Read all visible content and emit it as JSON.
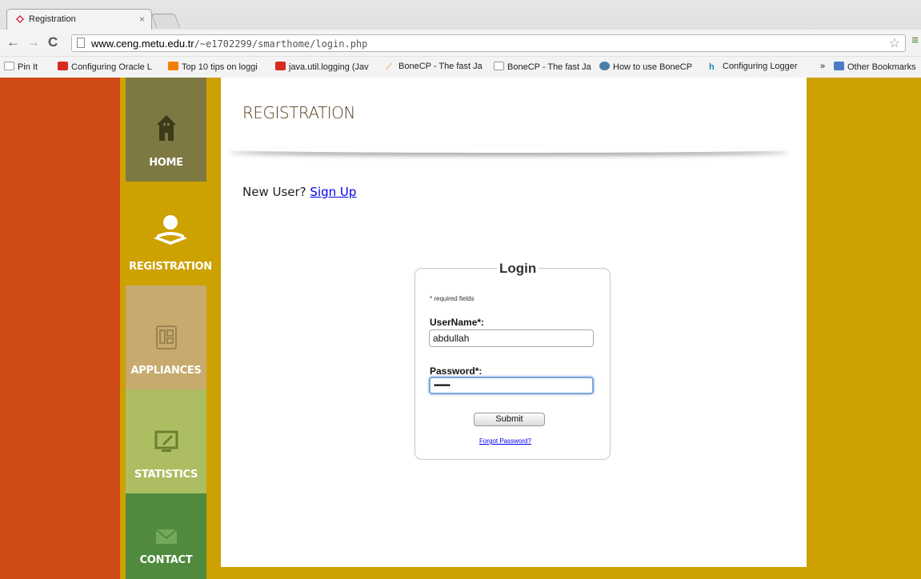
{
  "browser": {
    "tab_title": "Registration",
    "tab_close": "×",
    "url_host": "www.ceng.metu.edu.tr",
    "url_path": "/~e1702299/smarthome/login.php",
    "bookmarks": [
      {
        "label": "Pin It",
        "icon": "page-icon"
      },
      {
        "label": "Configuring Oracle L",
        "icon": "oracle-icon"
      },
      {
        "label": "Top 10 tips on loggi",
        "icon": "blogger-icon"
      },
      {
        "label": "java.util.logging (Jav",
        "icon": "oracle-icon"
      },
      {
        "label": "BoneCP - The fast Ja",
        "icon": "bone-icon"
      },
      {
        "label": "BoneCP - The fast Ja",
        "icon": "page-icon"
      },
      {
        "label": "How to use BoneCP ",
        "icon": "wordpress-icon"
      },
      {
        "label": "Configuring Logger ",
        "icon": "hn-icon"
      }
    ],
    "bookmarks_overflow": "»",
    "other_bookmarks": "Other Bookmarks"
  },
  "nav": {
    "home": "HOME",
    "registration": "REGISTRATION",
    "appliances": "APPLIANCES",
    "statistics": "STATISTICS",
    "contact": "CONTACT"
  },
  "main": {
    "heading": "REGISTRATION",
    "new_user_text": "New User?",
    "sign_up_link": "Sign Up"
  },
  "login": {
    "legend": "Login",
    "required_note": "* required fields",
    "username_label": "UserName*:",
    "username_value": "abdullah",
    "password_label": "Password*:",
    "password_value": "••••••••",
    "submit_label": "Submit",
    "forgot_link": "Forgot Password?"
  },
  "colors": {
    "red": "#cf4a16",
    "mustard": "#cda100",
    "olive": "#7e7843",
    "tan": "#c6aa6e",
    "lime": "#acbd62",
    "green": "#4f8a3f"
  }
}
